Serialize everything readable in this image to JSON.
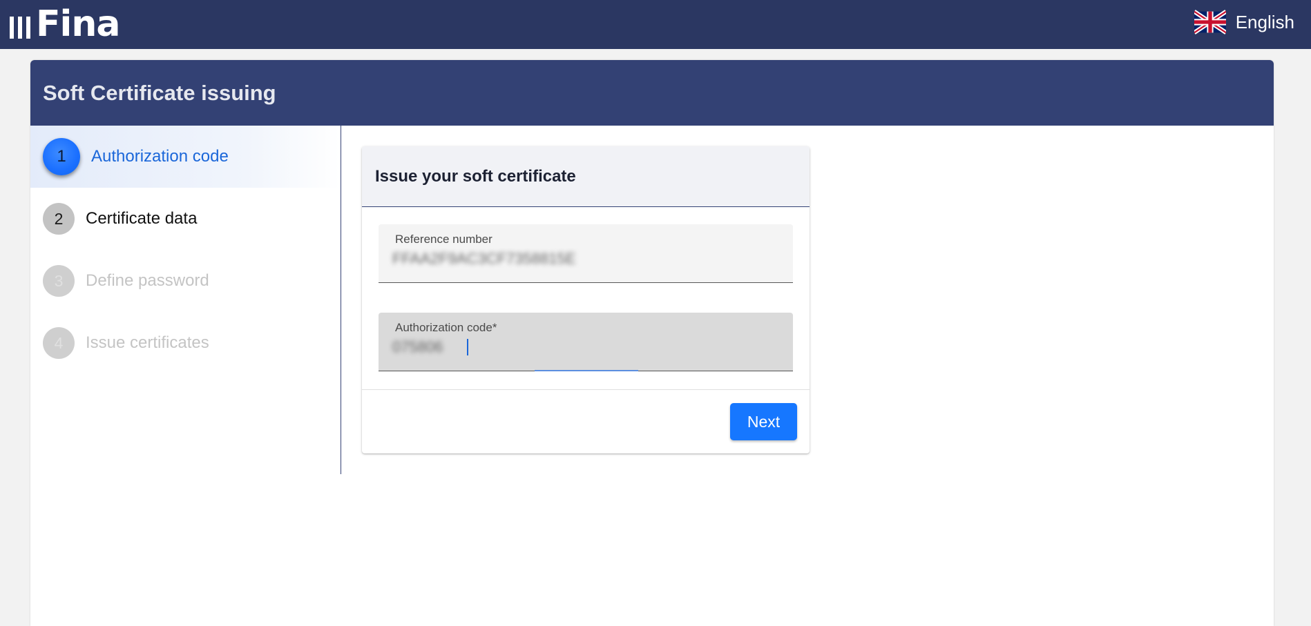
{
  "topbar": {
    "logo_text": "Fina",
    "language_label": "English",
    "language_flag": "uk-flag-icon"
  },
  "panel": {
    "title": "Soft Certificate issuing"
  },
  "stepper": {
    "steps": [
      {
        "number": "1",
        "label": "Authorization code",
        "state": "active"
      },
      {
        "number": "2",
        "label": "Certificate data",
        "state": "enabled"
      },
      {
        "number": "3",
        "label": "Define password",
        "state": "disabled"
      },
      {
        "number": "4",
        "label": "Issue certificates",
        "state": "disabled"
      }
    ]
  },
  "card": {
    "title": "Issue your soft certificate",
    "reference_field": {
      "label": "Reference number",
      "value": "FFAA2F9AC3CF7358815E"
    },
    "authorization_field": {
      "label": "Authorization code*",
      "value": "075806"
    },
    "next_label": "Next"
  },
  "colors": {
    "topbar_bg": "#2b3762",
    "panel_header_bg": "#334174",
    "accent_blue": "#1677ff",
    "active_step_text": "#1a66d9"
  }
}
